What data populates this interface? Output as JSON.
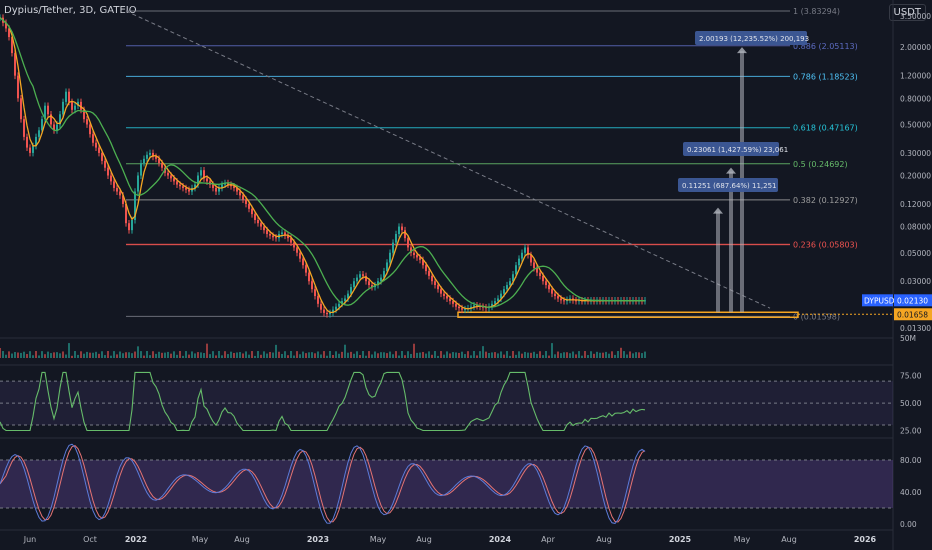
{
  "header": {
    "title": "Dypius/Tether, 3D, GATEIO"
  },
  "currency_button": "USDT",
  "colors": {
    "background": "#131722",
    "candle_up": "#26a69a",
    "candle_down": "#ef5350",
    "ma_fast": "#f5a623",
    "ma_slow": "#4caf50",
    "trend_line": "#787b86",
    "rsi_line": "#66bb6a",
    "stoch_k": "#5c7bd9",
    "stoch_d": "#e57373",
    "price_badge": "#2962ff",
    "support_badge": "#f5a623"
  },
  "chart_data": [
    {
      "type": "candlestick",
      "title": "Dypius/Tether, 3D, GATEIO",
      "ylabel": "USDT",
      "yscale": "log",
      "ylim": [
        0.0125,
        3.9
      ],
      "y_ticks": [
        3.5,
        2.0,
        1.2,
        0.8,
        0.5,
        0.3,
        0.2,
        0.12,
        0.08,
        0.05,
        0.03,
        0.01658,
        0.013
      ],
      "y_tick_labels": [
        "3.50000",
        "2.00000",
        "1.20000",
        "0.80000",
        "0.50000",
        "0.30000",
        "0.20000",
        "0.12000",
        "0.08000",
        "0.05000",
        "0.03000",
        "0.01658",
        "0.01300"
      ],
      "x_ticks": [
        "Jun",
        "Oct",
        "2022",
        "May",
        "Aug",
        "2023",
        "May",
        "Aug",
        "2024",
        "Apr",
        "Aug",
        "2025",
        "May",
        "Aug",
        "2026"
      ],
      "x": [
        0,
        3,
        6,
        9,
        12,
        15,
        18,
        21,
        24,
        27,
        30,
        33,
        36,
        39,
        42,
        45,
        48,
        51,
        54,
        57,
        60,
        63,
        66,
        69,
        72,
        75,
        78,
        81,
        84,
        87,
        90,
        93,
        96,
        99,
        102,
        105,
        108,
        111,
        114,
        117,
        120,
        123,
        126,
        129,
        132,
        135,
        138,
        141,
        144,
        147,
        150,
        153,
        156,
        159,
        162,
        165,
        168,
        171,
        174,
        177,
        180,
        183,
        186,
        189,
        192,
        195,
        198,
        201,
        204,
        207,
        210,
        213,
        216,
        219,
        222,
        225,
        228,
        231,
        234,
        237,
        240,
        243,
        246,
        249,
        252,
        255,
        258,
        261,
        264,
        267,
        270,
        273,
        276,
        279,
        282,
        285,
        288,
        291,
        294,
        297,
        300,
        303,
        306,
        309,
        312,
        315,
        318,
        321,
        324,
        327,
        330,
        333,
        336,
        339,
        342,
        345,
        348,
        351,
        354,
        357,
        360,
        363,
        366,
        369,
        372,
        375,
        378,
        381,
        384,
        387,
        390,
        393,
        396,
        399,
        402,
        405,
        408,
        411,
        414,
        417,
        420,
        423,
        426,
        429,
        432,
        435,
        438,
        441,
        444,
        447,
        450,
        453,
        456,
        459,
        462,
        465,
        468,
        471,
        474,
        477,
        480,
        483,
        486,
        489,
        492,
        495,
        498,
        501,
        504,
        507,
        510,
        513,
        516,
        519,
        522,
        525,
        528,
        531,
        534,
        537,
        540,
        543,
        546,
        549,
        552,
        555,
        558,
        561,
        564,
        567,
        570,
        573,
        576,
        579,
        582,
        585,
        588,
        591,
        594,
        597,
        600,
        603,
        606,
        609,
        612,
        615,
        618,
        621,
        624,
        627,
        630,
        633,
        636,
        639,
        642,
        645,
        648,
        651,
        654,
        657,
        660,
        663,
        666,
        669,
        672,
        675,
        678,
        681,
        684,
        687,
        690
      ],
      "close": [
        3.4,
        3.1,
        2.8,
        2.4,
        1.8,
        1.2,
        0.8,
        0.55,
        0.4,
        0.33,
        0.3,
        0.34,
        0.4,
        0.45,
        0.55,
        0.7,
        0.6,
        0.5,
        0.45,
        0.5,
        0.6,
        0.75,
        0.9,
        0.75,
        0.65,
        0.7,
        0.75,
        0.65,
        0.55,
        0.5,
        0.42,
        0.36,
        0.33,
        0.3,
        0.26,
        0.23,
        0.2,
        0.18,
        0.16,
        0.15,
        0.14,
        0.12,
        0.085,
        0.075,
        0.09,
        0.15,
        0.2,
        0.25,
        0.27,
        0.29,
        0.3,
        0.28,
        0.27,
        0.25,
        0.23,
        0.21,
        0.2,
        0.19,
        0.18,
        0.17,
        0.165,
        0.16,
        0.155,
        0.15,
        0.16,
        0.17,
        0.2,
        0.22,
        0.19,
        0.18,
        0.17,
        0.16,
        0.15,
        0.16,
        0.17,
        0.175,
        0.17,
        0.165,
        0.16,
        0.15,
        0.14,
        0.13,
        0.12,
        0.11,
        0.1,
        0.09,
        0.085,
        0.08,
        0.075,
        0.07,
        0.068,
        0.066,
        0.065,
        0.07,
        0.072,
        0.068,
        0.065,
        0.06,
        0.055,
        0.05,
        0.045,
        0.04,
        0.035,
        0.03,
        0.026,
        0.023,
        0.02,
        0.018,
        0.017,
        0.0166,
        0.017,
        0.018,
        0.019,
        0.02,
        0.021,
        0.022,
        0.024,
        0.027,
        0.03,
        0.032,
        0.034,
        0.033,
        0.03,
        0.028,
        0.027,
        0.028,
        0.03,
        0.032,
        0.036,
        0.042,
        0.05,
        0.06,
        0.07,
        0.08,
        0.075,
        0.065,
        0.055,
        0.05,
        0.048,
        0.046,
        0.044,
        0.04,
        0.036,
        0.033,
        0.03,
        0.028,
        0.026,
        0.024,
        0.023,
        0.022,
        0.021,
        0.02,
        0.019,
        0.0185,
        0.018,
        0.0182,
        0.0185,
        0.019,
        0.0195,
        0.0192,
        0.019,
        0.0188,
        0.0185,
        0.019,
        0.02,
        0.021,
        0.022,
        0.024,
        0.026,
        0.028,
        0.03,
        0.034,
        0.04,
        0.045,
        0.05,
        0.055,
        0.048,
        0.042,
        0.038,
        0.035,
        0.033,
        0.03,
        0.028,
        0.026,
        0.024,
        0.023,
        0.022,
        0.0213,
        0.021,
        0.0215,
        0.022,
        0.0213,
        0.021,
        0.0213,
        0.021,
        0.0213,
        0.021,
        0.0213,
        0.021,
        0.0213,
        0.021,
        0.0213,
        0.021,
        0.0213,
        0.021,
        0.0213,
        0.021,
        0.0213,
        0.021,
        0.0213,
        0.021,
        0.0213,
        0.021,
        0.0213,
        0.021,
        0.0213
      ],
      "fibonacci": [
        {
          "label": "1 (3.83294)",
          "value": 3.83294,
          "color": "#787b86"
        },
        {
          "label": "0.886 (2.05113)",
          "value": 2.05113,
          "color": "#5c6bc0"
        },
        {
          "label": "0.786 (1.18523)",
          "value": 1.18523,
          "color": "#4fc3f7"
        },
        {
          "label": "0.618 (0.47167)",
          "value": 0.47167,
          "color": "#26c6da"
        },
        {
          "label": "0.5 (0.24692)",
          "value": 0.24692,
          "color": "#66bb6a"
        },
        {
          "label": "0.382 (0.12927)",
          "value": 0.12927,
          "color": "#9e9e9e"
        },
        {
          "label": "0.236 (0.05803)",
          "value": 0.05803,
          "color": "#ef5350"
        },
        {
          "label": "0 (0.01598)",
          "value": 0.01598,
          "color": "#787b86"
        }
      ],
      "targets": [
        {
          "label": "2.00193 (12,235.52%) 200,193",
          "value": 2.00193
        },
        {
          "label": "0.23061 (1,427.59%) 23,061",
          "value": 0.23061
        },
        {
          "label": "0.11251 (687.64%) 11,251",
          "value": 0.11251
        }
      ],
      "last_price": {
        "symbol": "DYPUSDT",
        "value": "0.02130"
      },
      "support_price": {
        "value": "0.01658"
      },
      "support_level": 0.01658
    },
    {
      "type": "bar",
      "title": "",
      "ylabel": "Volume",
      "y_tick_labels": [
        "50M"
      ]
    },
    {
      "type": "line",
      "title": "",
      "ylabel": "RSI",
      "ylim": [
        20,
        82
      ],
      "y_tick_labels": [
        "75.00",
        "50.00",
        "25.00"
      ],
      "bands": [
        30,
        70
      ]
    },
    {
      "type": "line",
      "title": "",
      "ylabel": "Stochastic RSI",
      "ylim": [
        -5,
        105
      ],
      "y_tick_labels": [
        "80.00",
        "40.00",
        "0.00"
      ],
      "bands": [
        20,
        80
      ]
    }
  ]
}
